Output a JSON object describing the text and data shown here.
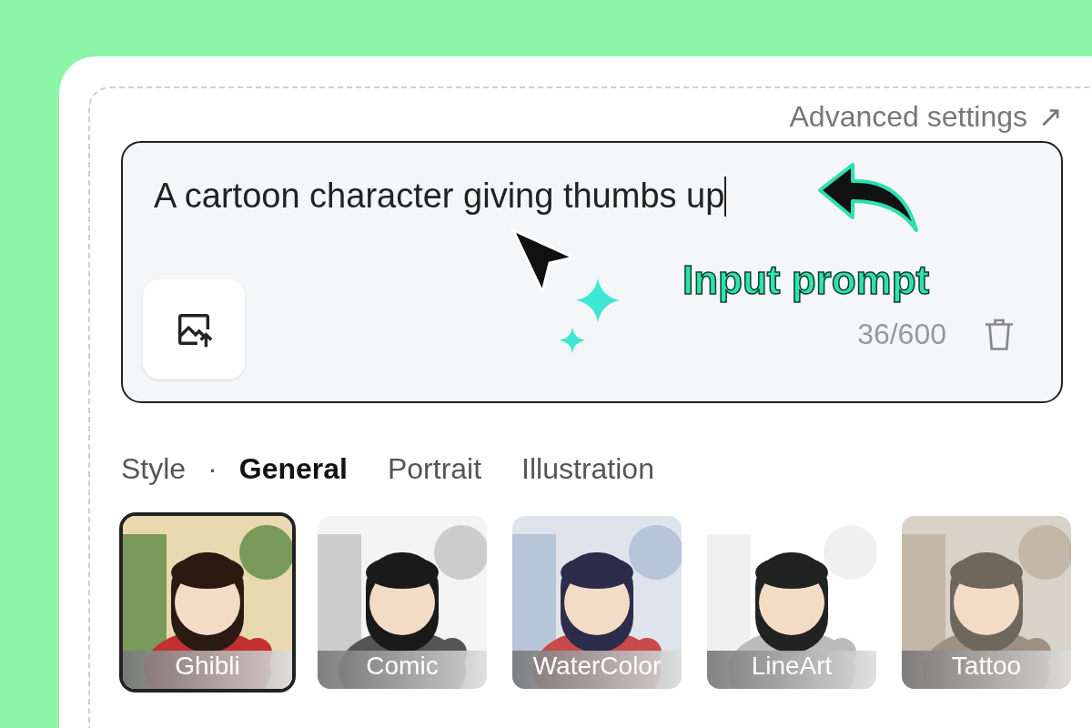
{
  "advanced_settings": {
    "label": "Advanced settings",
    "icon": "↗"
  },
  "prompt": {
    "value": "A cartoon character giving thumbs up",
    "counter": "36/600"
  },
  "annotation": {
    "label": "Input prompt"
  },
  "style": {
    "label": "Style",
    "separator": "·",
    "tabs": [
      {
        "label": "General",
        "selected": true
      },
      {
        "label": "Portrait",
        "selected": false
      },
      {
        "label": "Illustration",
        "selected": false
      }
    ],
    "presets": [
      {
        "label": "Ghibli",
        "selected": true,
        "kind": "picture"
      },
      {
        "label": "Comic",
        "selected": false,
        "kind": "picture"
      },
      {
        "label": "WaterColor",
        "selected": false,
        "kind": "picture"
      },
      {
        "label": "LineArt",
        "selected": false,
        "kind": "picture"
      },
      {
        "label": "Tattoo",
        "selected": false,
        "kind": "picture"
      }
    ]
  }
}
